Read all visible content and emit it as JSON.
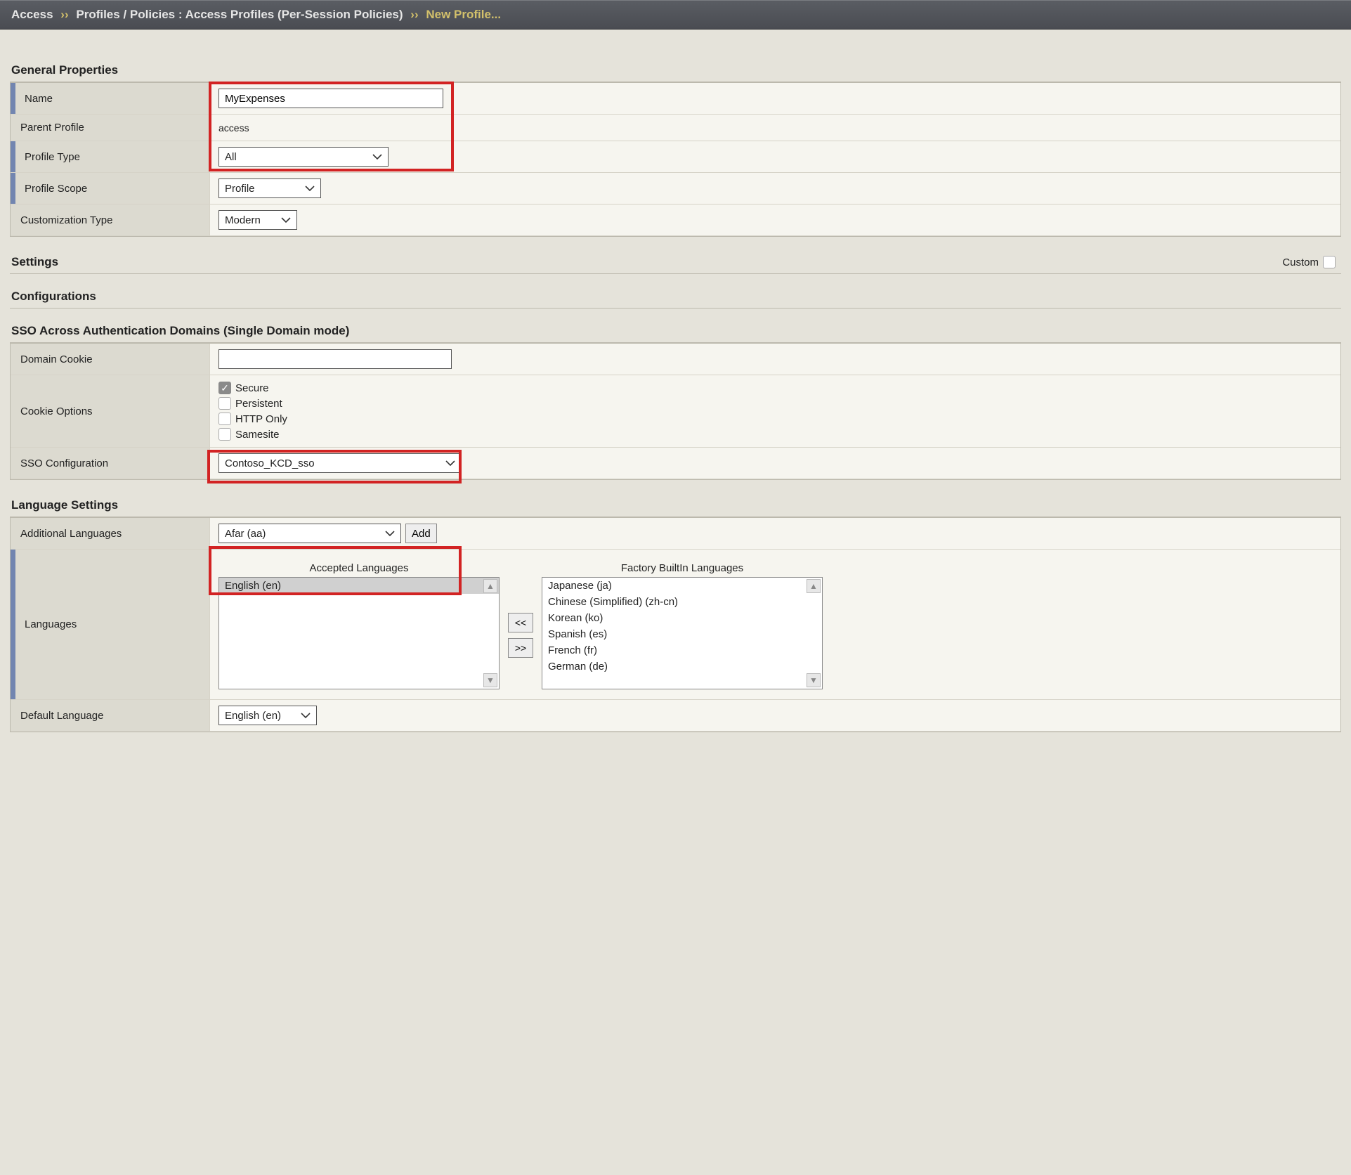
{
  "breadcrumb": {
    "root": "Access",
    "sep": "››",
    "mid": "Profiles / Policies : Access Profiles (Per-Session Policies)",
    "current": "New Profile..."
  },
  "sections": {
    "general": "General Properties",
    "settings": "Settings",
    "configurations": "Configurations",
    "sso_domains": "SSO Across Authentication Domains (Single Domain mode)",
    "language": "Language Settings"
  },
  "general": {
    "name_label": "Name",
    "name_value": "MyExpenses",
    "parent_label": "Parent Profile",
    "parent_value": "access",
    "type_label": "Profile Type",
    "type_value": "All",
    "scope_label": "Profile Scope",
    "scope_value": "Profile",
    "custom_type_label": "Customization Type",
    "custom_type_value": "Modern"
  },
  "settings": {
    "custom_label": "Custom"
  },
  "sso": {
    "domain_cookie_label": "Domain Cookie",
    "domain_cookie_value": "",
    "cookie_options_label": "Cookie Options",
    "opt_secure": "Secure",
    "opt_persistent": "Persistent",
    "opt_httponly": "HTTP Only",
    "opt_samesite": "Samesite",
    "sso_config_label": "SSO Configuration",
    "sso_config_value": "Contoso_KCD_sso"
  },
  "lang": {
    "additional_label": "Additional Languages",
    "additional_value": "Afar (aa)",
    "add_btn": "Add",
    "languages_label": "Languages",
    "accepted_title": "Accepted Languages",
    "factory_title": "Factory BuiltIn Languages",
    "accepted_list": [
      "English (en)"
    ],
    "factory_list": [
      "Japanese (ja)",
      "Chinese (Simplified) (zh-cn)",
      "Korean (ko)",
      "Spanish (es)",
      "French (fr)",
      "German (de)"
    ],
    "move_left": "<<",
    "move_right": ">>",
    "default_label": "Default Language",
    "default_value": "English (en)"
  }
}
